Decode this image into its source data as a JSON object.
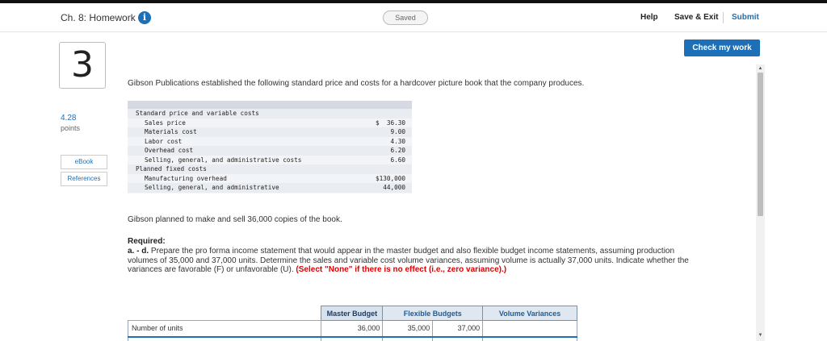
{
  "header": {
    "title": "Ch. 8: Homework",
    "info_icon": "i",
    "saved_status": "Saved",
    "help_label": "Help",
    "save_exit_label": "Save & Exit",
    "submit_label": "Submit"
  },
  "check_my_work_label": "Check my work",
  "question": {
    "number": "3",
    "points_value": "4.28",
    "points_label": "points",
    "ebook_label": "eBook",
    "references_label": "References",
    "intro": "Gibson Publications established the following standard price and costs for a hardcover picture book that the company produces.",
    "cost_rows": [
      {
        "label": "Standard price and variable costs",
        "value": "",
        "indent": 0
      },
      {
        "label": "Sales price",
        "value": "$  36.30",
        "indent": 1
      },
      {
        "label": "Materials cost",
        "value": "9.00",
        "indent": 1
      },
      {
        "label": "Labor cost",
        "value": "4.30",
        "indent": 1
      },
      {
        "label": "Overhead cost",
        "value": "6.20",
        "indent": 1
      },
      {
        "label": "Selling, general, and administrative costs",
        "value": "6.60",
        "indent": 1
      },
      {
        "label": "Planned fixed costs",
        "value": "",
        "indent": 0
      },
      {
        "label": "Manufacturing overhead",
        "value": "$130,000",
        "indent": 1
      },
      {
        "label": "Selling, general, and administrative",
        "value": "44,000",
        "indent": 1
      }
    ],
    "planned_text": "Gibson planned to make and sell 36,000 copies of the book.",
    "required_label": "Required:",
    "required_part": "a. - d.",
    "required_text": " Prepare the pro forma income statement that would appear in the master budget and also flexible budget income statements, assuming production volumes of 35,000 and 37,000 units. Determine the sales and variable cost volume variances, assuming volume is actually 37,000 units. Indicate whether the variances are favorable (F) or unfavorable (U). ",
    "required_red": "(Select \"None\" if there is no effect (i.e., zero variance).)"
  },
  "answer_table": {
    "headers": {
      "master_budget": "Master Budget",
      "flexible_budgets": "Flexible Budgets",
      "volume_variances": "Volume Variances"
    },
    "row_units": {
      "label": "Number of units",
      "master": "36,000",
      "flex1": "35,000",
      "flex2": "37,000"
    }
  },
  "colors": {
    "accent": "#1d6fb8",
    "warning": "#e00000"
  }
}
